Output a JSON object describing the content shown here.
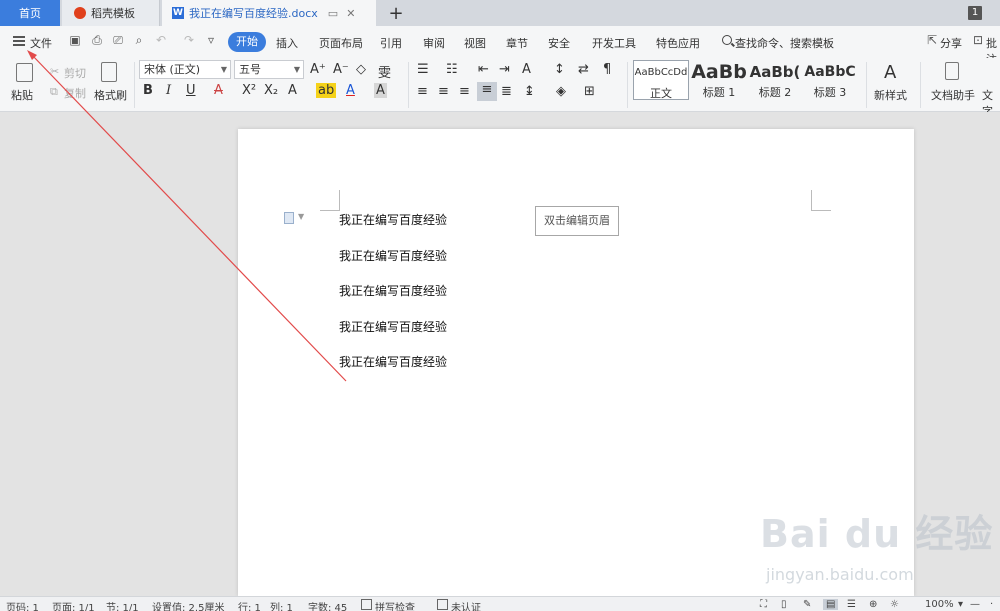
{
  "tabs": {
    "home": "首页",
    "template": "稻壳模板",
    "document": "我正在编写百度经验.docx",
    "page_badge": "1"
  },
  "menu": {
    "file": "文件",
    "items": [
      "开始",
      "插入",
      "页面布局",
      "引用",
      "审阅",
      "视图",
      "章节",
      "安全",
      "开发工具",
      "特色应用"
    ],
    "search": "查找命令、搜索模板",
    "share": "分享",
    "annotate": "批注"
  },
  "ribbon": {
    "paste": "粘贴",
    "cut": "剪切",
    "copy": "复制",
    "format_painter": "格式刷",
    "font_name": "宋体 (正文)",
    "font_size": "五号",
    "styles": [
      {
        "preview": "AaBbCcDd",
        "label": "正文"
      },
      {
        "preview": "AaBb",
        "label": "标题 1"
      },
      {
        "preview": "AaBb(",
        "label": "标题 2"
      },
      {
        "preview": "AaBbC",
        "label": "标题 3"
      }
    ],
    "new_style": "新样式",
    "doc_assistant": "文档助手",
    "text_tool": "文字"
  },
  "document": {
    "lines": [
      "我正在编写百度经验",
      "我正在编写百度经验",
      "我正在编写百度经验",
      "我正在编写百度经验",
      "我正在编写百度经验"
    ],
    "header_hint": "双击编辑页眉"
  },
  "status": {
    "page": "页码: 1",
    "pages": "页面: 1/1",
    "section": "节: 1/1",
    "setting": "设置值: 2.5厘米",
    "row": "行: 1",
    "col": "列: 1",
    "words": "字数: 45",
    "spell": "拼写检查",
    "cert": "未认证",
    "zoom": "100%"
  },
  "watermark": {
    "main": "Bai du 经验",
    "sub": "jingyan.baidu.com"
  },
  "colors": {
    "accent": "#3b7ddd",
    "annotation": "#e24a4a"
  }
}
